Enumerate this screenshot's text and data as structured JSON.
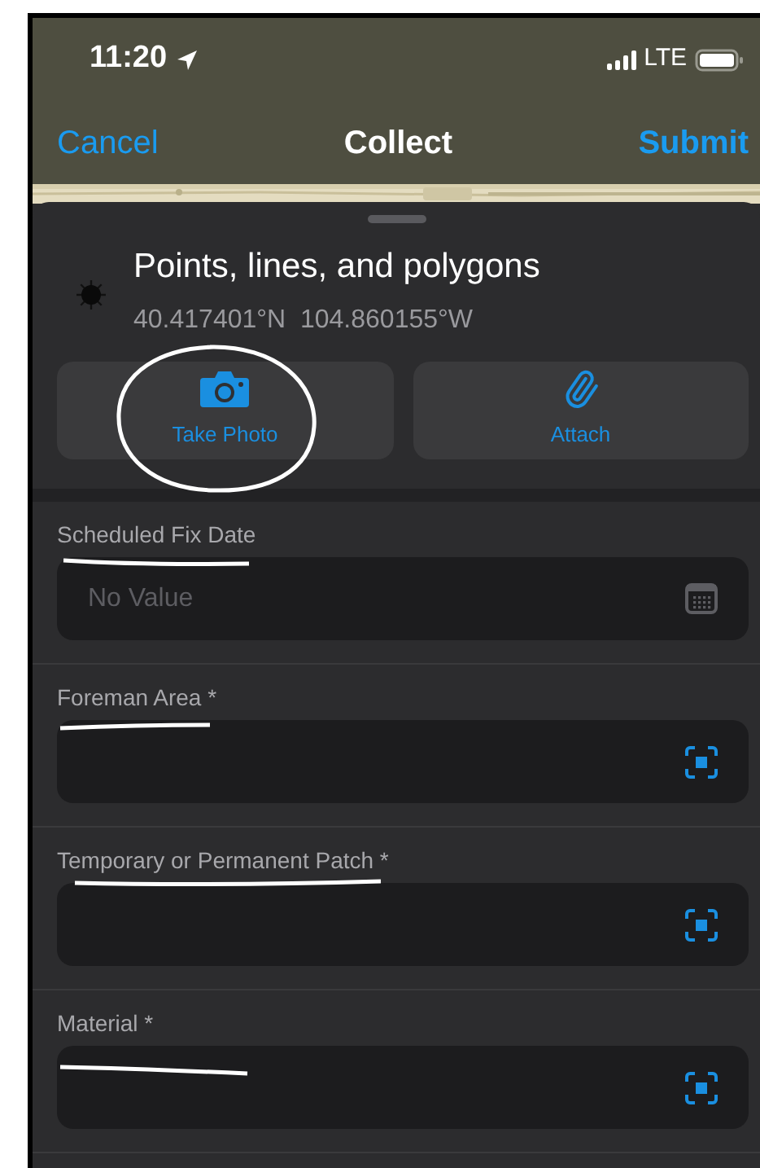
{
  "status_bar": {
    "time": "11:20",
    "network": "LTE"
  },
  "nav": {
    "cancel": "Cancel",
    "title": "Collect",
    "submit": "Submit"
  },
  "feature": {
    "title": "Points, lines, and polygons",
    "coordinates": "40.417401°N  104.860155°W"
  },
  "actions": [
    {
      "label": "Take Photo",
      "kind": "camera"
    },
    {
      "label": "Attach",
      "kind": "attach"
    }
  ],
  "fields": [
    {
      "label": "Scheduled Fix Date",
      "placeholder": "No Value",
      "kind": "date"
    },
    {
      "label": "Foreman Area *",
      "kind": "scan"
    },
    {
      "label": "Temporary or Permanent Patch *",
      "kind": "scan"
    },
    {
      "label": "Material *",
      "kind": "scan"
    }
  ]
}
